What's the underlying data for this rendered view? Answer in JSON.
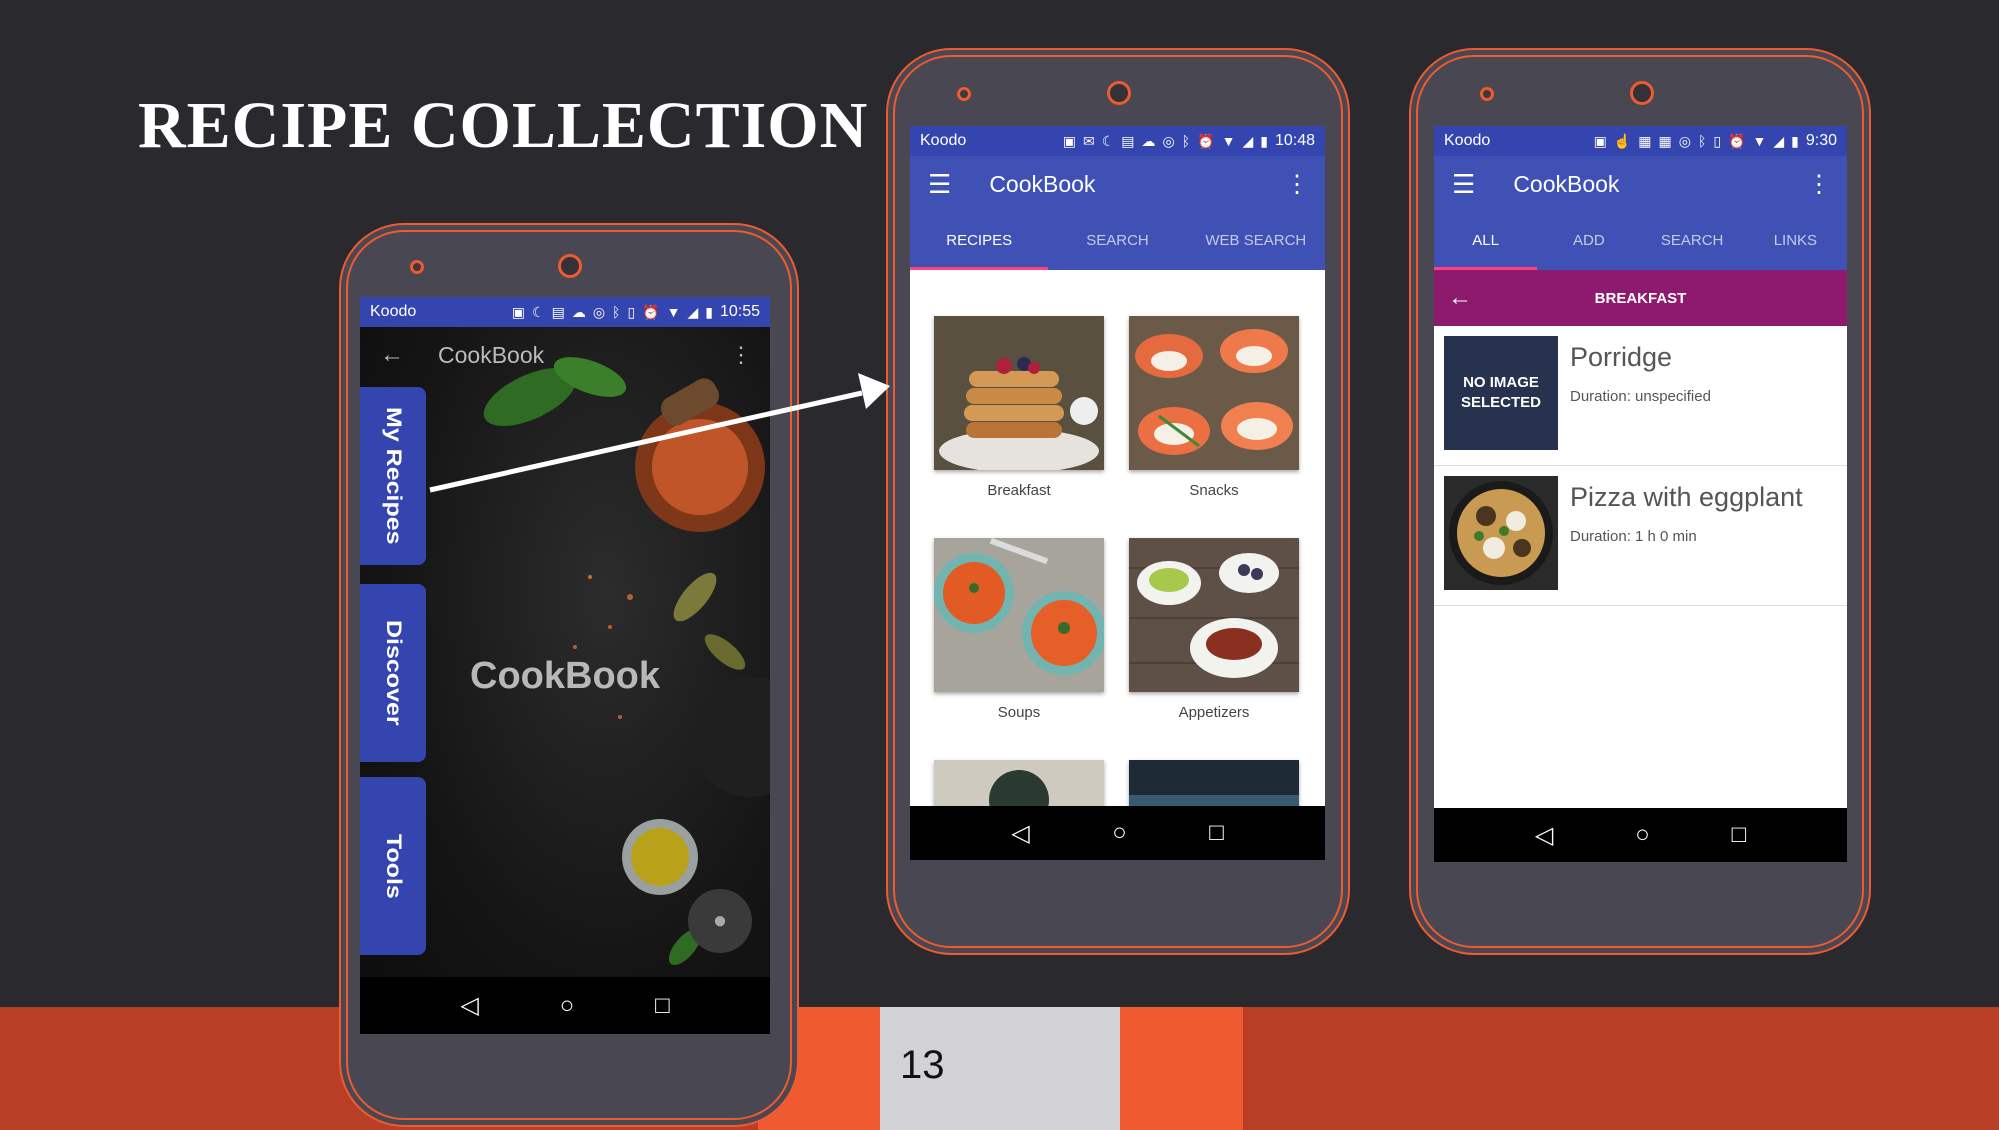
{
  "slide": {
    "title": "RECIPE COLLECTION",
    "page_number": "13"
  },
  "phone1": {
    "status": {
      "carrier": "Koodo",
      "time": "10:55"
    },
    "app_title": "CookBook",
    "center_title": "CookBook",
    "side_tabs": [
      "My Recipes",
      "Discover",
      "Tools"
    ]
  },
  "phone2": {
    "status": {
      "carrier": "Koodo",
      "time": "10:48"
    },
    "app_title": "CookBook",
    "tabs": [
      "RECIPES",
      "SEARCH",
      "WEB SEARCH"
    ],
    "categories": [
      "Breakfast",
      "Snacks",
      "Soups",
      "Appetizers"
    ]
  },
  "phone3": {
    "status": {
      "carrier": "Koodo",
      "time": "9:30"
    },
    "app_title": "CookBook",
    "tabs": [
      "ALL",
      "ADD",
      "SEARCH",
      "LINKS"
    ],
    "section_header": "BREAKFAST",
    "recipes": [
      {
        "title": "Porridge",
        "duration": "Duration: unspecified",
        "image_placeholder": "NO IMAGE SELECTED"
      },
      {
        "title": "Pizza with eggplant",
        "duration": "Duration: 1 h 0 min"
      }
    ]
  },
  "colors": {
    "primary": "#3f51b5",
    "accent": "#ff4081",
    "section_header": "#8e1a6e",
    "phone_outline": "#ef5a30"
  }
}
